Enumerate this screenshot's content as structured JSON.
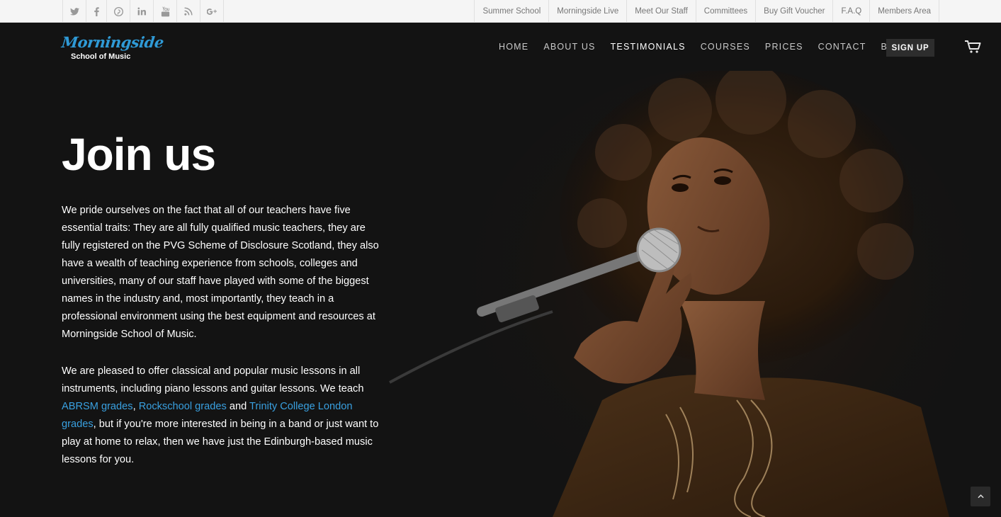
{
  "social": [
    {
      "icon": "twitter-icon"
    },
    {
      "icon": "facebook-icon"
    },
    {
      "icon": "pinterest-icon"
    },
    {
      "icon": "linkedin-icon"
    },
    {
      "icon": "youtube-icon"
    },
    {
      "icon": "rss-icon"
    },
    {
      "icon": "google-plus-icon"
    }
  ],
  "utility_links": [
    "Summer School",
    "Morningside Live",
    "Meet Our Staff",
    "Committees",
    "Buy Gift Voucher",
    "F.A.Q",
    "Members Area"
  ],
  "logo": {
    "script": "Morningside",
    "sub": "School of Music"
  },
  "nav": [
    "HOME",
    "ABOUT US",
    "TESTIMONIALS",
    "COURSES",
    "PRICES",
    "CONTACT",
    "BLOG"
  ],
  "nav_active": "TESTIMONIALS",
  "signup_label": "SIGN UP",
  "colors": {
    "background": "#131313",
    "link": "#39a0e0",
    "logo_blue": "#2f9ad6"
  },
  "main": {
    "title": "Join us",
    "para1": "We pride ourselves on the fact that all of our teachers have five essential traits: They are all fully qualified music teachers, they are fully registered on the PVG Scheme of Disclosure Scotland, they also have a wealth of teaching experience from schools, colleges and universities, many of our staff have played with some of the biggest names in the industry and, most importantly, they teach in a professional environment using the best equipment and resources at Morningside School of Music.",
    "para2": {
      "intro": "We are pleased to offer classical and popular music lessons in all instruments, including piano lessons and guitar lessons. We teach ",
      "link1": "ABRSM grades",
      "sep1": ", ",
      "link2": "Rockschool grades",
      "sep2": " and ",
      "link3": "Trinity College London grades",
      "outro": ", but if you're more interested in being in a band or just want to play at home to relax, then we have just the Edinburgh-based music lessons for you."
    }
  }
}
